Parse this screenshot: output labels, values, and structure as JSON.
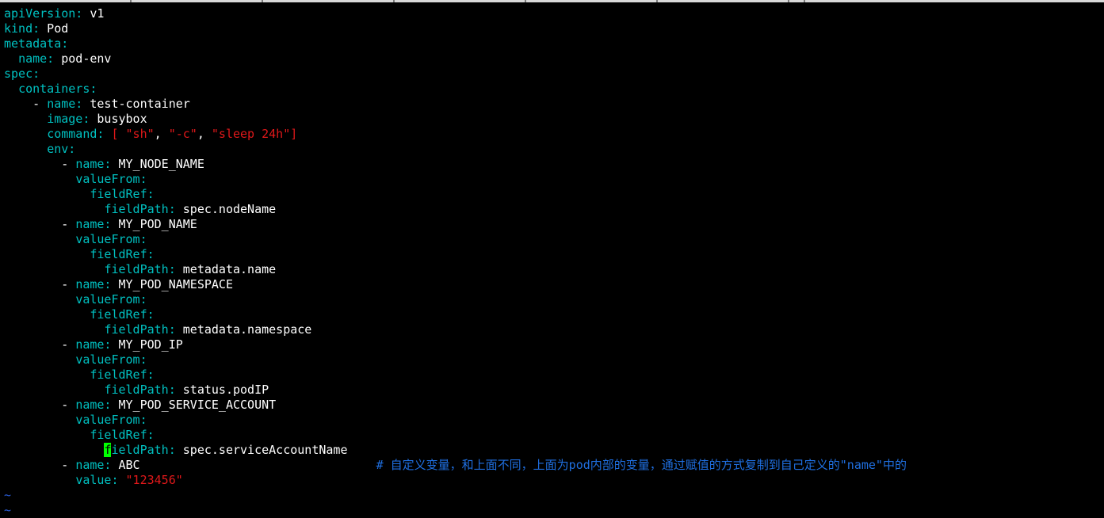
{
  "editor": {
    "lines": {
      "l1": {
        "key": "apiVersion:",
        "val": " v1"
      },
      "l2": {
        "key": "kind:",
        "val": " Pod"
      },
      "l3": {
        "key": "metadata:"
      },
      "l4": {
        "indent": "  ",
        "key": "name:",
        "val": " pod-env"
      },
      "l5": {
        "key": "spec:"
      },
      "l6": {
        "indent": "  ",
        "key": "containers:"
      },
      "l7": {
        "indent": "    - ",
        "key": "name:",
        "val": " test-container"
      },
      "l8": {
        "indent": "      ",
        "key": "image:",
        "val": " busybox"
      },
      "l9": {
        "indent": "      ",
        "key": "command:",
        "open": " [ ",
        "s1": "\"sh\"",
        "sep1": ", ",
        "s2": "\"-c\"",
        "sep2": ", ",
        "s3": "\"sleep 24h\"",
        "close": "]"
      },
      "l10": {
        "indent": "      ",
        "key": "env:"
      },
      "l11": {
        "indent": "        - ",
        "key": "name:",
        "val": " MY_NODE_NAME"
      },
      "l12": {
        "indent": "          ",
        "key": "valueFrom:"
      },
      "l13": {
        "indent": "            ",
        "key": "fieldRef:"
      },
      "l14": {
        "indent": "              ",
        "key": "fieldPath:",
        "val": " spec.nodeName"
      },
      "l15": {
        "indent": "        - ",
        "key": "name:",
        "val": " MY_POD_NAME"
      },
      "l16": {
        "indent": "          ",
        "key": "valueFrom:"
      },
      "l17": {
        "indent": "            ",
        "key": "fieldRef:"
      },
      "l18": {
        "indent": "              ",
        "key": "fieldPath:",
        "val": " metadata.name"
      },
      "l19": {
        "indent": "        - ",
        "key": "name:",
        "val": " MY_POD_NAMESPACE"
      },
      "l20": {
        "indent": "          ",
        "key": "valueFrom:"
      },
      "l21": {
        "indent": "            ",
        "key": "fieldRef:"
      },
      "l22": {
        "indent": "              ",
        "key": "fieldPath:",
        "val": " metadata.namespace"
      },
      "l23": {
        "indent": "        - ",
        "key": "name:",
        "val": " MY_POD_IP"
      },
      "l24": {
        "indent": "          ",
        "key": "valueFrom:"
      },
      "l25": {
        "indent": "            ",
        "key": "fieldRef:"
      },
      "l26": {
        "indent": "              ",
        "key": "fieldPath:",
        "val": " status.podIP"
      },
      "l27": {
        "indent": "        - ",
        "key": "name:",
        "val": " MY_POD_SERVICE_ACCOUNT"
      },
      "l28": {
        "indent": "          ",
        "key": "valueFrom:"
      },
      "l29": {
        "indent": "            ",
        "key": "fieldRef:"
      },
      "l30": {
        "indent": "              ",
        "cursor_char": "f",
        "key": "ieldPath:",
        "val": " spec.serviceAccountName"
      },
      "l31": {
        "indent": "        - ",
        "key": "name:",
        "val": " ABC",
        "pad": "                                 ",
        "comment": "# 自定义变量，和上面不同，上面为pod内部的变量，通过赋值的方式复制到自己定义的\"name\"中的"
      },
      "l32": {
        "indent": "          ",
        "key": "value:",
        "str": " \"123456\""
      },
      "tilde1": "~",
      "tilde2": "~"
    }
  },
  "colors": {
    "background": "#000000",
    "key": "#00c0c0",
    "value": "#ffffff",
    "string": "#e0181a",
    "comment": "#1f6fe0",
    "cursor": "#00ff00"
  }
}
